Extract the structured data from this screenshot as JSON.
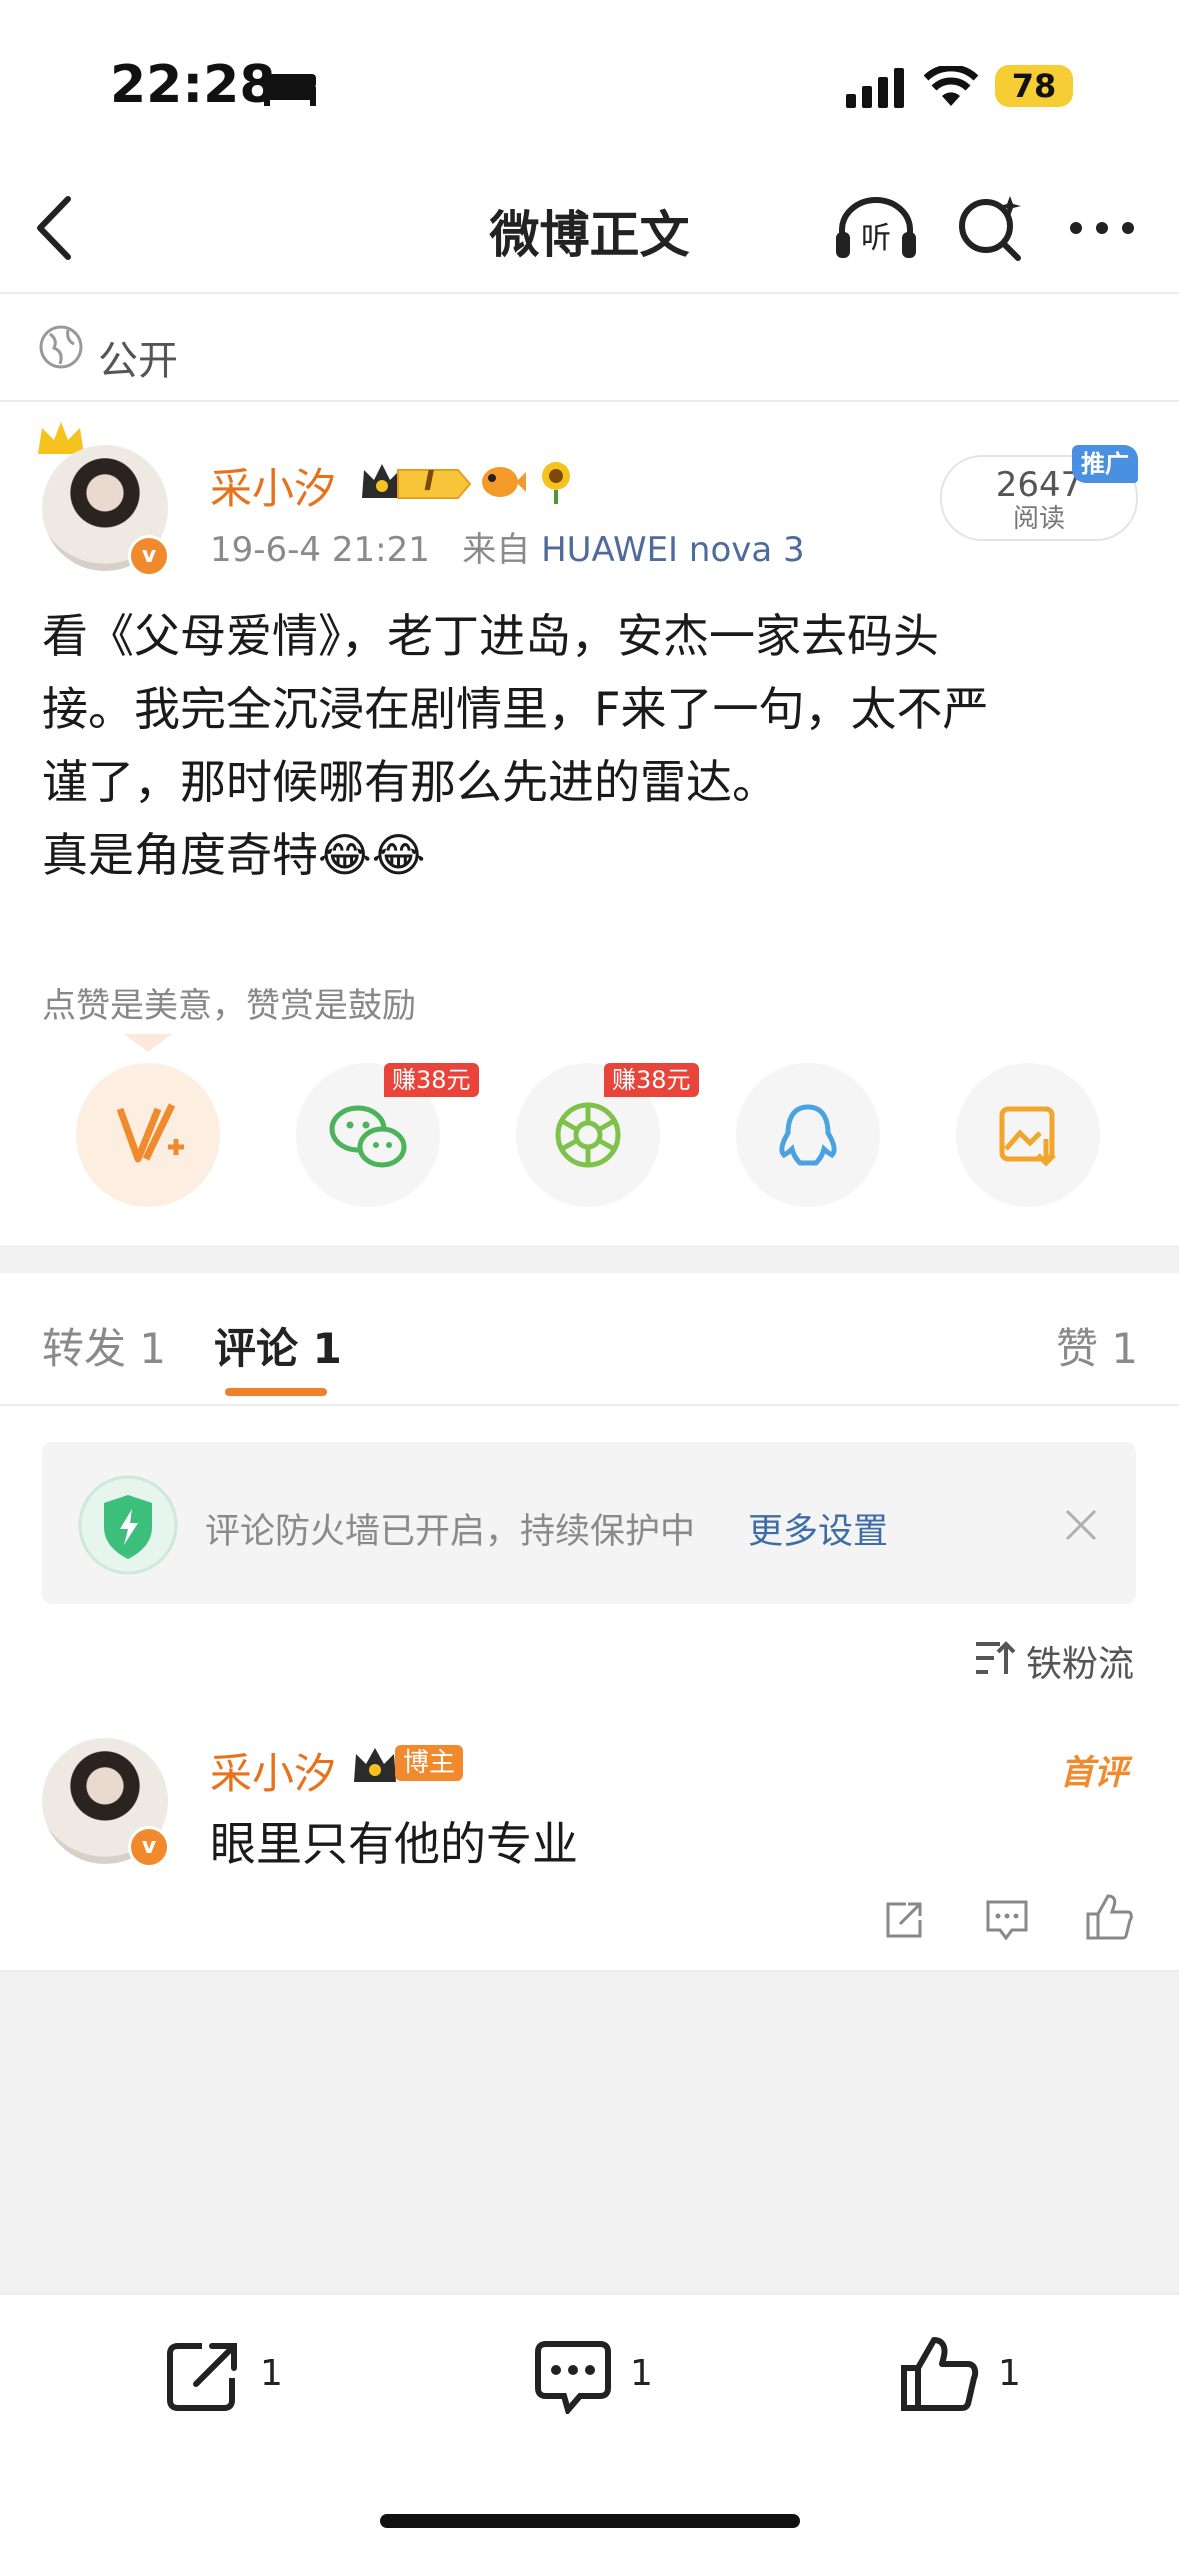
{
  "status_bar": {
    "time": "22:28",
    "battery": "78"
  },
  "nav": {
    "title": "微博正文"
  },
  "visibility": {
    "label": "公开"
  },
  "post": {
    "author": "采小汐",
    "level_badge": "I",
    "timestamp": "19-6-4 21:21",
    "source_prefix": "来自",
    "device": "HUAWEI nova 3",
    "read_count": "2647",
    "read_label": "阅读",
    "promo_label": "推广",
    "text_lines": [
      "看《父母爱情》，老丁进岛，安杰一家去码头",
      "接。我完全沉浸在剧情里，F来了一句，太不严",
      "谨了，那时候哪有那么先进的雷达。",
      "真是角度奇特😂😂"
    ],
    "reward_tip": "点赞是美意，赞赏是鼓励"
  },
  "share": {
    "wechat_earn": "赚38元",
    "moments_earn": "赚38元"
  },
  "tabs": {
    "repost": "转发 1",
    "comment": "评论 1",
    "like": "赞 1"
  },
  "firewall": {
    "text": "评论防火墙已开启，持续保护中",
    "link": "更多设置"
  },
  "sort": {
    "label": "铁粉流"
  },
  "comment": {
    "author": "采小汐",
    "badge": "博主",
    "first_label": "首评",
    "text": "眼里只有他的专业"
  },
  "bottom_bar": {
    "repost_count": "1",
    "comment_count": "1",
    "like_count": "1"
  },
  "colors": {
    "accent": "#f08a2c",
    "link": "#3d6ca6",
    "name": "#e8711c"
  }
}
